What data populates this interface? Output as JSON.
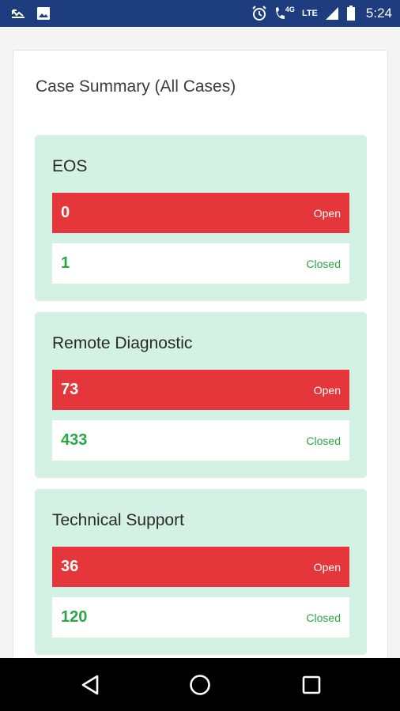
{
  "status_bar": {
    "icons_left": [
      "missed-call-icon",
      "image-icon"
    ],
    "icons_right": [
      "alarm-icon",
      "call-4g-icon",
      "lte-icon",
      "signal-icon",
      "battery-icon"
    ],
    "network_4g": "4G",
    "network_lte": "LTE",
    "time": "5:24",
    "background": "#1d3d7e"
  },
  "card": {
    "title": "Case Summary (All Cases)",
    "sections": [
      {
        "name": "EOS",
        "open": {
          "count": "0",
          "label": "Open"
        },
        "closed": {
          "count": "1",
          "label": "Closed"
        }
      },
      {
        "name": "Remote Diagnostic",
        "open": {
          "count": "73",
          "label": "Open"
        },
        "closed": {
          "count": "433",
          "label": "Closed"
        }
      },
      {
        "name": "Technical Support",
        "open": {
          "count": "36",
          "label": "Open"
        },
        "closed": {
          "count": "120",
          "label": "Closed"
        }
      }
    ]
  },
  "colors": {
    "section_bg": "#d4f2e3",
    "open_bg": "#e5363c",
    "closed_text": "#27a745"
  },
  "nav_bar": {
    "buttons": [
      "back-icon",
      "home-icon",
      "recent-apps-icon"
    ]
  }
}
